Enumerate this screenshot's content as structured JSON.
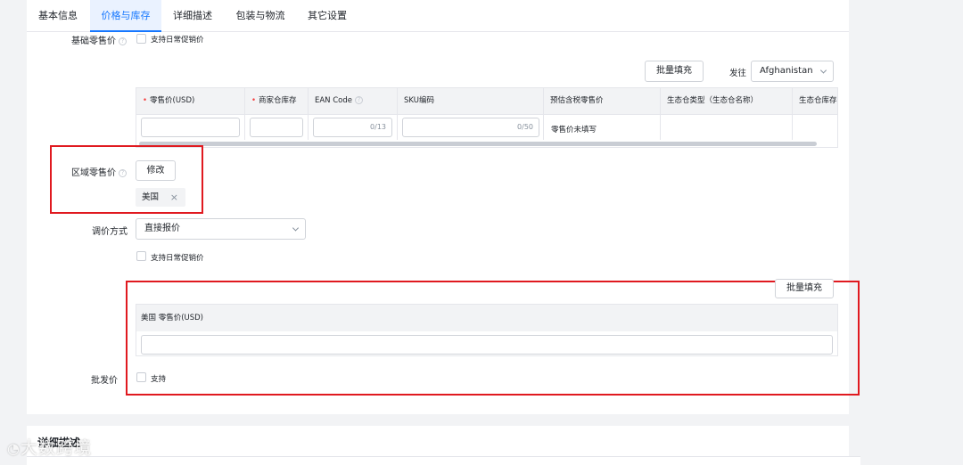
{
  "tabs": [
    {
      "label": "基本信息",
      "active": false
    },
    {
      "label": "价格与库存",
      "active": true
    },
    {
      "label": "详细描述",
      "active": false
    },
    {
      "label": "包装与物流",
      "active": false
    },
    {
      "label": "其它设置",
      "active": false
    }
  ],
  "base_price": {
    "label": "基础零售价",
    "promo_label": "支持日常促销价"
  },
  "toolbar": {
    "bulk_fill": "批量填充",
    "ship_label": "发往",
    "country": "Afghanistan"
  },
  "sku_table": {
    "headers": [
      "零售价(USD)",
      "商家仓库存",
      "EAN Code",
      "SKU编码",
      "预估含税零售价",
      "生态仓类型（生态仓名称）",
      "生态仓库存"
    ],
    "ean_count": "0/13",
    "sku_count": "0/50",
    "est_price": "零售价未填写"
  },
  "regional_price": {
    "label": "区域零售价",
    "edit_button": "修改",
    "tag": "美国"
  },
  "pricing_method": {
    "label": "调价方式",
    "value": "直接报价",
    "promo_label": "支持日常促销价"
  },
  "regional_table": {
    "bulk_fill": "批量填充",
    "header": "美国 零售价(USD)"
  },
  "wholesale": {
    "label": "批发价",
    "support_label": "支持"
  },
  "section": {
    "title": "详细描述"
  },
  "watermark": "大数跨境",
  "colors": {
    "accent": "#1677ff",
    "highlight": "#e0191f"
  }
}
